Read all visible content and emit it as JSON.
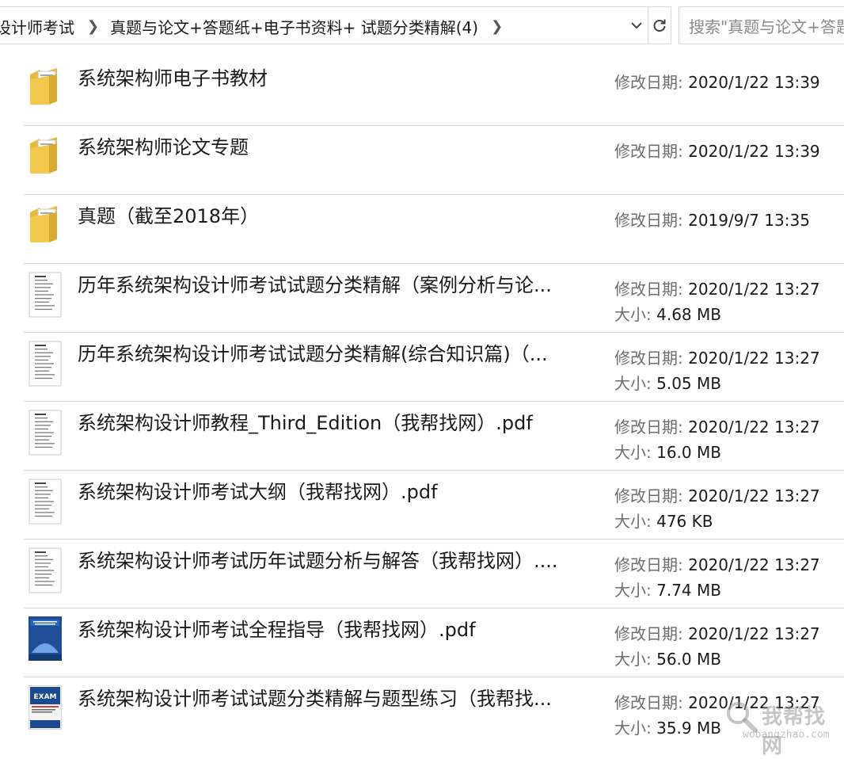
{
  "address": {
    "breadcrumbs": [
      "设计师考试",
      "真题与论文+答题纸+电子书资料+ 试题分类精解(4)"
    ],
    "search_placeholder": "搜索\"真题与论文+答题"
  },
  "labels": {
    "modified": "修改日期:",
    "size": "大小:"
  },
  "files": [
    {
      "name": "系统架构师电子书教材",
      "type": "folder",
      "modified": "2020/1/22 13:39",
      "size": ""
    },
    {
      "name": "系统架构师论文专题",
      "type": "folder",
      "modified": "2020/1/22 13:39",
      "size": ""
    },
    {
      "name": "真题（截至2018年）",
      "type": "folder",
      "modified": "2019/9/7 13:35",
      "size": ""
    },
    {
      "name": "历年系统架构设计师考试试题分类精解（案例分析与论...",
      "type": "document",
      "modified": "2020/1/22 13:27",
      "size": "4.68 MB"
    },
    {
      "name": "历年系统架构设计师考试试题分类精解(综合知识篇)（...",
      "type": "document",
      "modified": "2020/1/22 13:27",
      "size": "5.05 MB"
    },
    {
      "name": "系统架构设计师教程_Third_Edition（我帮找网）.pdf",
      "type": "document",
      "modified": "2020/1/22 13:27",
      "size": "16.0 MB"
    },
    {
      "name": "系统架构设计师考试大纲（我帮找网）.pdf",
      "type": "document",
      "modified": "2020/1/22 13:27",
      "size": "476 KB"
    },
    {
      "name": "系统架构设计师考试历年试题分析与解答（我帮找网）....",
      "type": "document",
      "modified": "2020/1/22 13:27",
      "size": "7.74 MB"
    },
    {
      "name": "系统架构设计师考试全程指导（我帮找网）.pdf",
      "type": "book-blue",
      "modified": "2020/1/22 13:27",
      "size": "56.0 MB"
    },
    {
      "name": "系统架构设计师考试试题分类精解与题型练习（我帮找...",
      "type": "book-exam",
      "modified": "2020/1/22 13:27",
      "size": "35.9 MB"
    }
  ],
  "watermark": {
    "text": "我帮找网",
    "sub": "wobangzhao.com"
  },
  "colors": {
    "folder": "#f2c94c",
    "divider": "#d4d4d4",
    "label": "#6d6d6d"
  }
}
